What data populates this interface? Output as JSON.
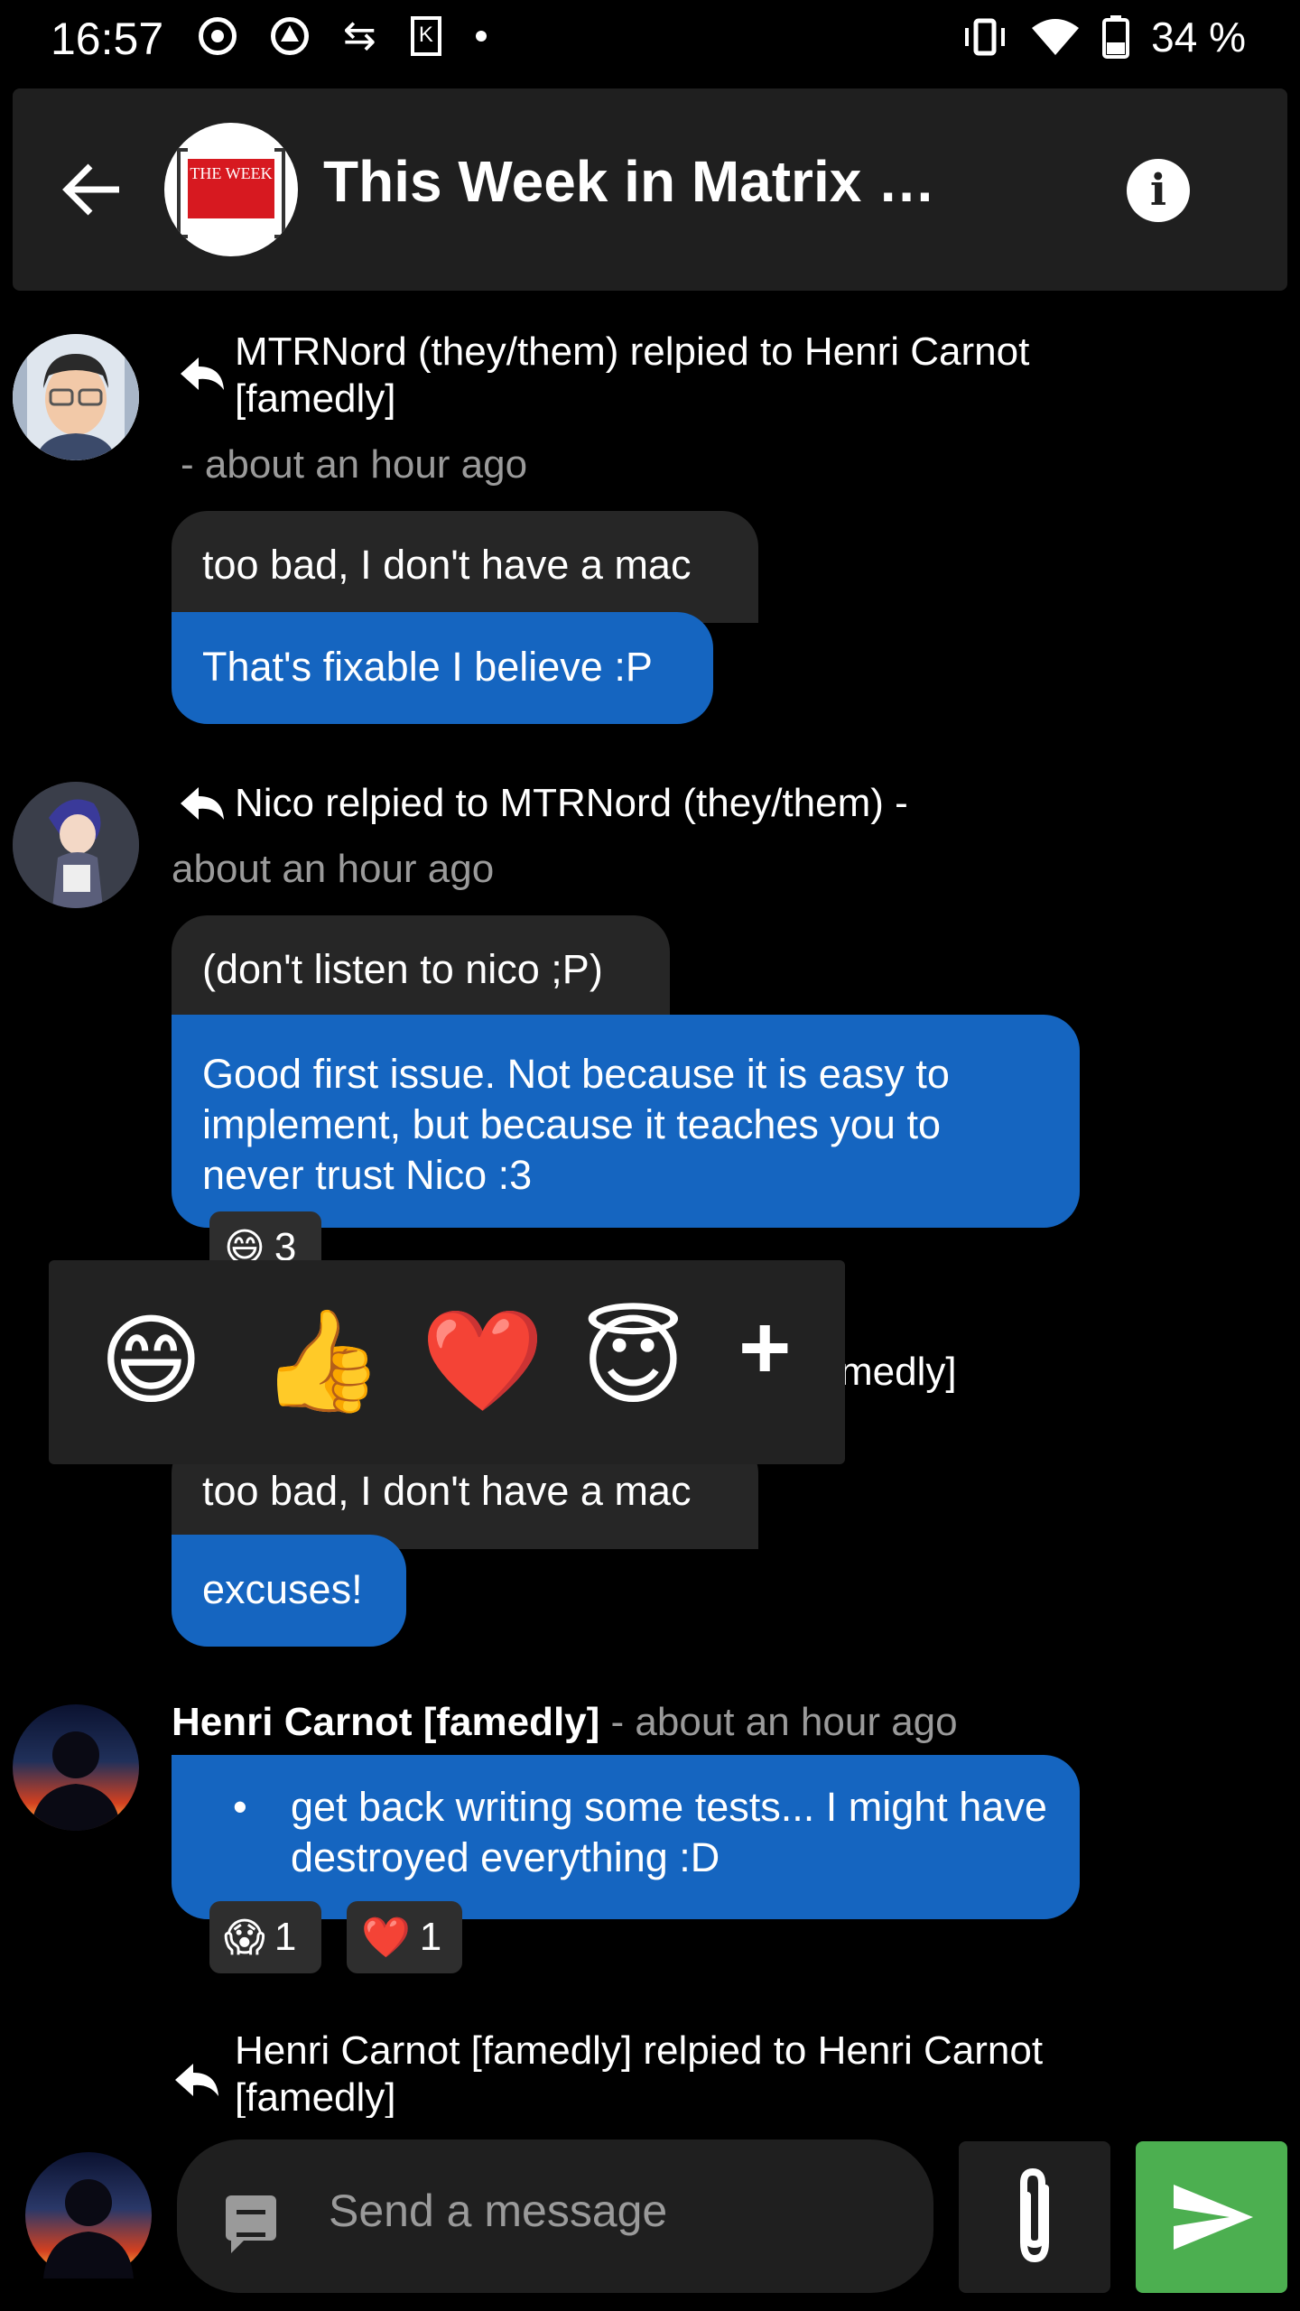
{
  "status_bar": {
    "time": "16:57",
    "battery": "34 %"
  },
  "header": {
    "room_title": "This Week in Matrix …",
    "room_avatar_text": "THE WEEK"
  },
  "messages": [
    {
      "reply_text": "MTRNord (they/them) relpied to Henri Carnot [famedly]",
      "time": "- about an hour ago",
      "quoted": "too bad, I don't have a mac",
      "body": "That's fixable I believe :P"
    },
    {
      "reply_text": "Nico relpied to MTRNord (they/them) -",
      "time": "about an hour ago",
      "quoted": "(don't listen to nico ;P)",
      "body": "Good first issue. Not because it is easy to implement, but because it teaches you to never trust Nico :3",
      "reaction_emoji": "😄",
      "reaction_count": "3"
    },
    {
      "partial_text": "medly]",
      "quoted": "too bad, I don't have a mac",
      "body": "excuses!"
    },
    {
      "sender": "Henri Carnot [famedly]",
      "time": "- about an hour ago",
      "body": "get back writing some tests... I might have destroyed everything :D",
      "reactions": [
        {
          "emoji": "😱",
          "count": "1"
        },
        {
          "emoji": "❤️",
          "count": "1"
        }
      ]
    },
    {
      "reply_text": "Henri Carnot [famedly] relpied to Henri Carnot [famedly]"
    }
  ],
  "reaction_picker": {
    "emojis": [
      "😄",
      "👍",
      "❤️",
      "😇"
    ],
    "more": "+"
  },
  "composer": {
    "placeholder": "Send a message"
  }
}
